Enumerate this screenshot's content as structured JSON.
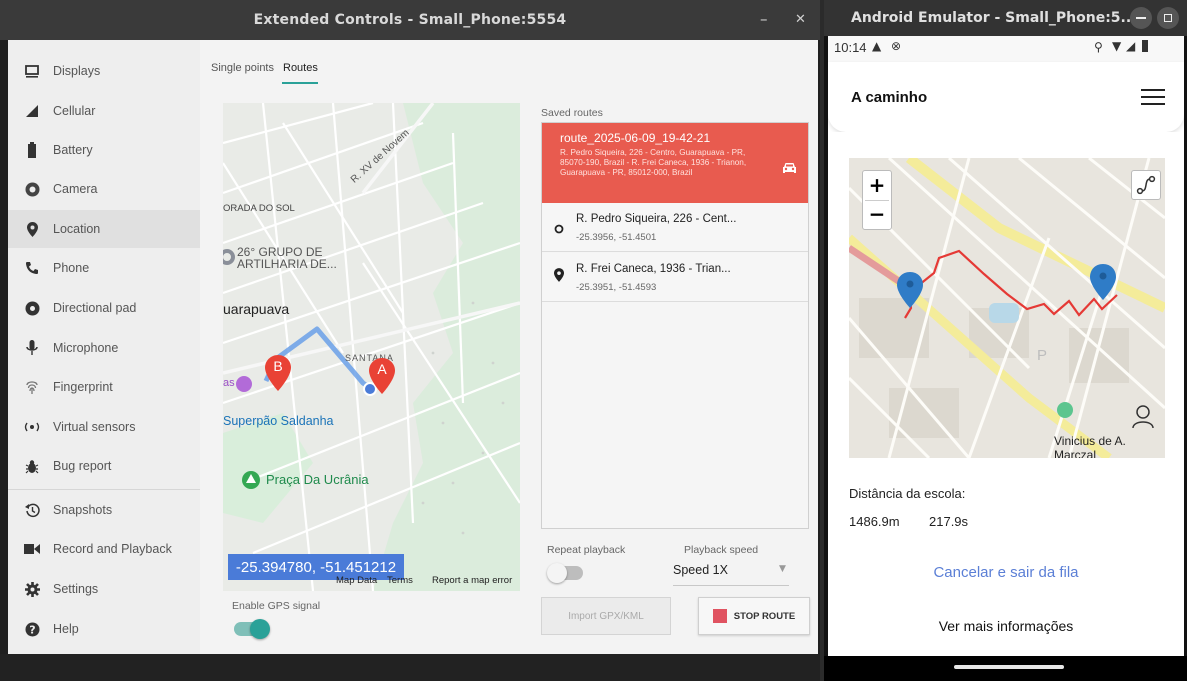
{
  "extended_controls": {
    "title": "Extended Controls - Small_Phone:5554",
    "minimize_glyph": "–",
    "close_glyph": "✕",
    "sidebar": [
      {
        "label": "Displays",
        "icon": "display-icon"
      },
      {
        "label": "Cellular",
        "icon": "cellular-icon"
      },
      {
        "label": "Battery",
        "icon": "battery-icon"
      },
      {
        "label": "Camera",
        "icon": "camera-icon"
      },
      {
        "label": "Location",
        "icon": "location-icon"
      },
      {
        "label": "Phone",
        "icon": "phone-icon"
      },
      {
        "label": "Directional pad",
        "icon": "dpad-icon"
      },
      {
        "label": "Microphone",
        "icon": "microphone-icon"
      },
      {
        "label": "Fingerprint",
        "icon": "fingerprint-icon"
      },
      {
        "label": "Virtual sensors",
        "icon": "sensors-icon"
      },
      {
        "label": "Bug report",
        "icon": "bug-icon"
      },
      {
        "label": "Snapshots",
        "icon": "history-icon"
      },
      {
        "label": "Record and Playback",
        "icon": "video-icon"
      },
      {
        "label": "Settings",
        "icon": "gear-icon"
      },
      {
        "label": "Help",
        "icon": "help-icon"
      }
    ],
    "active_item": "Location",
    "tabs": {
      "single": "Single points",
      "routes": "Routes",
      "active": "Routes"
    },
    "map": {
      "labels": {
        "street": "R. XV de Novem",
        "area1": "ORADA DO SOL",
        "group1": "26° GRUPO DE",
        "group2": "ARTILHARIA DE...",
        "city": "uarapuava",
        "santana": "SANTANA",
        "superpao": "Superpão Saldanha",
        "praca": "Praça Da Ucrânia",
        "poi_edge": "as",
        "marker_a": "A",
        "marker_b": "B"
      },
      "coordinates": "-25.394780, -51.451212",
      "footer": {
        "map_data": "Map Data",
        "terms": "Terms",
        "report": "Report a map error"
      }
    },
    "saved_routes_label": "Saved routes",
    "selected_route": {
      "name": "route_2025-06-09_19-42-21",
      "description": "R. Pedro Siqueira, 226 - Centro, Guarapuava - PR, 85070-190, Brazil - R. Frei Caneca, 1936 - Trianon, Guarapuava - PR, 85012-000, Brazil"
    },
    "waypoints": [
      {
        "name": "R. Pedro Siqueira, 226 - Cent...",
        "latlng": "-25.3956, -51.4501",
        "icon": "start-point-icon"
      },
      {
        "name": "R. Frei Caneca, 1936 - Trian...",
        "latlng": "-25.3951, -51.4593",
        "icon": "end-point-icon"
      }
    ],
    "gps": {
      "label": "Enable GPS signal",
      "enabled": true
    },
    "repeat": {
      "label": "Repeat playback",
      "enabled": false
    },
    "speed": {
      "label": "Playback speed",
      "value": "Speed 1X"
    },
    "import_button": "Import GPX/KML",
    "stop_button": "STOP ROUTE",
    "colors": {
      "accent": "#2aa198",
      "selected_route": "#e85b4f",
      "stop_square": "#e05361",
      "coord_pill": "#4a7bd8"
    }
  },
  "emulator": {
    "title": "Android Emulator - Small_Phone:5...",
    "status_time": "10:14",
    "app": {
      "title": "A caminho",
      "map_label_person": "Vinicius de A. Marczal",
      "map_zoom_in": "+",
      "map_zoom_out": "−",
      "distance_label": "Distância da escola:",
      "distance_value": "1486.9m",
      "time_value": "217.9s",
      "cancel_link": "Cancelar e sair da fila",
      "more_info": "Ver mais informações"
    },
    "colors": {
      "link": "#5b7fd6",
      "route": "#e53935"
    }
  }
}
